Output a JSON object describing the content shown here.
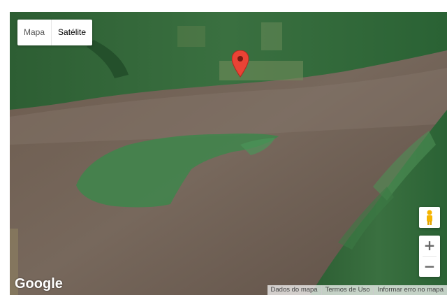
{
  "map": {
    "type_controls": {
      "map_label": "Mapa",
      "satellite_label": "Satélite",
      "active": "Satélite"
    },
    "marker": {
      "color": "#ea4335",
      "icon": "map-pin-icon"
    },
    "controls": {
      "pegman_icon": "pegman-icon",
      "zoom_in_label": "+",
      "zoom_out_label": "−"
    },
    "logo": "Google",
    "footer": {
      "map_data": "Dados do mapa",
      "terms": "Termos de Uso",
      "report": "Informar erro no mapa"
    },
    "colors": {
      "water": "#6e5c50",
      "forest": "#2e6a36",
      "island": "#3f8a4c",
      "pegman": "#f5b400"
    }
  }
}
